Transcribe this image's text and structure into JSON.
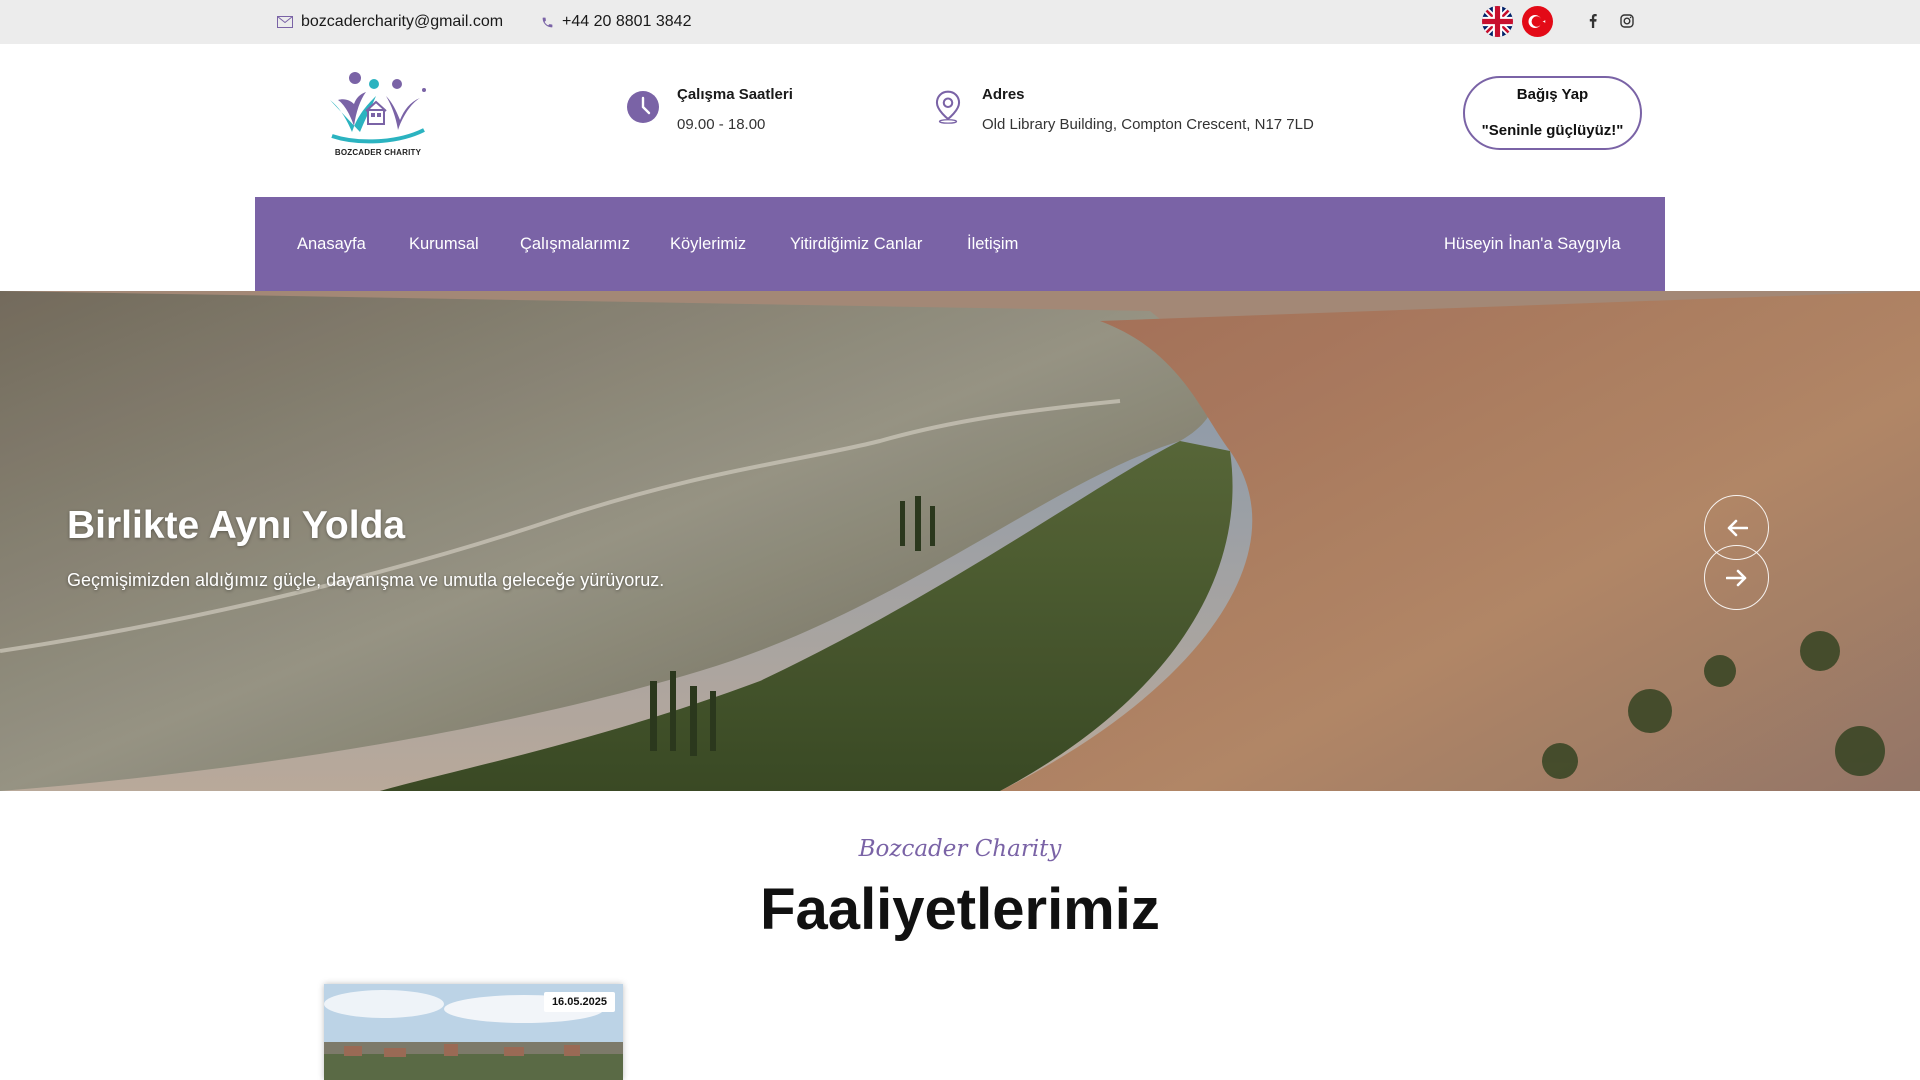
{
  "topbar": {
    "email": "bozcadercharity@gmail.com",
    "phone": "+44 20 8801 3842",
    "languages": [
      "English",
      "Türkçe"
    ],
    "social": [
      "facebook-icon",
      "instagram-icon"
    ]
  },
  "header": {
    "logo_text": "BOZCADER CHARITY",
    "hours_label": "Çalışma Saatleri",
    "hours_value": "09.00 - 18.00",
    "address_label": "Adres",
    "address_value": "Old Library Building, Compton Crescent, N17 7LD",
    "donate_line1": "Bağış Yap",
    "donate_line2": "\"Seninle güçlüyüz!\""
  },
  "nav": {
    "items": [
      "Anasayfa",
      "Kurumsal",
      "Çalışmalarımız",
      "Köylerimiz",
      "Yitirdiğimiz Canlar",
      "İletişim"
    ],
    "right_item": "Hüseyin İnan'a Saygıyla"
  },
  "hero": {
    "title": "Birlikte Aynı Yolda",
    "subtitle": "Geçmişimizden aldığımız güçle, dayanışma ve umutla geleceğe yürüyoruz."
  },
  "section": {
    "kicker": "Bozcader Charity",
    "heading": "Faaliyetlerimiz"
  },
  "cards": [
    {
      "date": "16.05.2025"
    }
  ],
  "colors": {
    "accent": "#7a63a6",
    "topbar_bg": "#ececec"
  }
}
